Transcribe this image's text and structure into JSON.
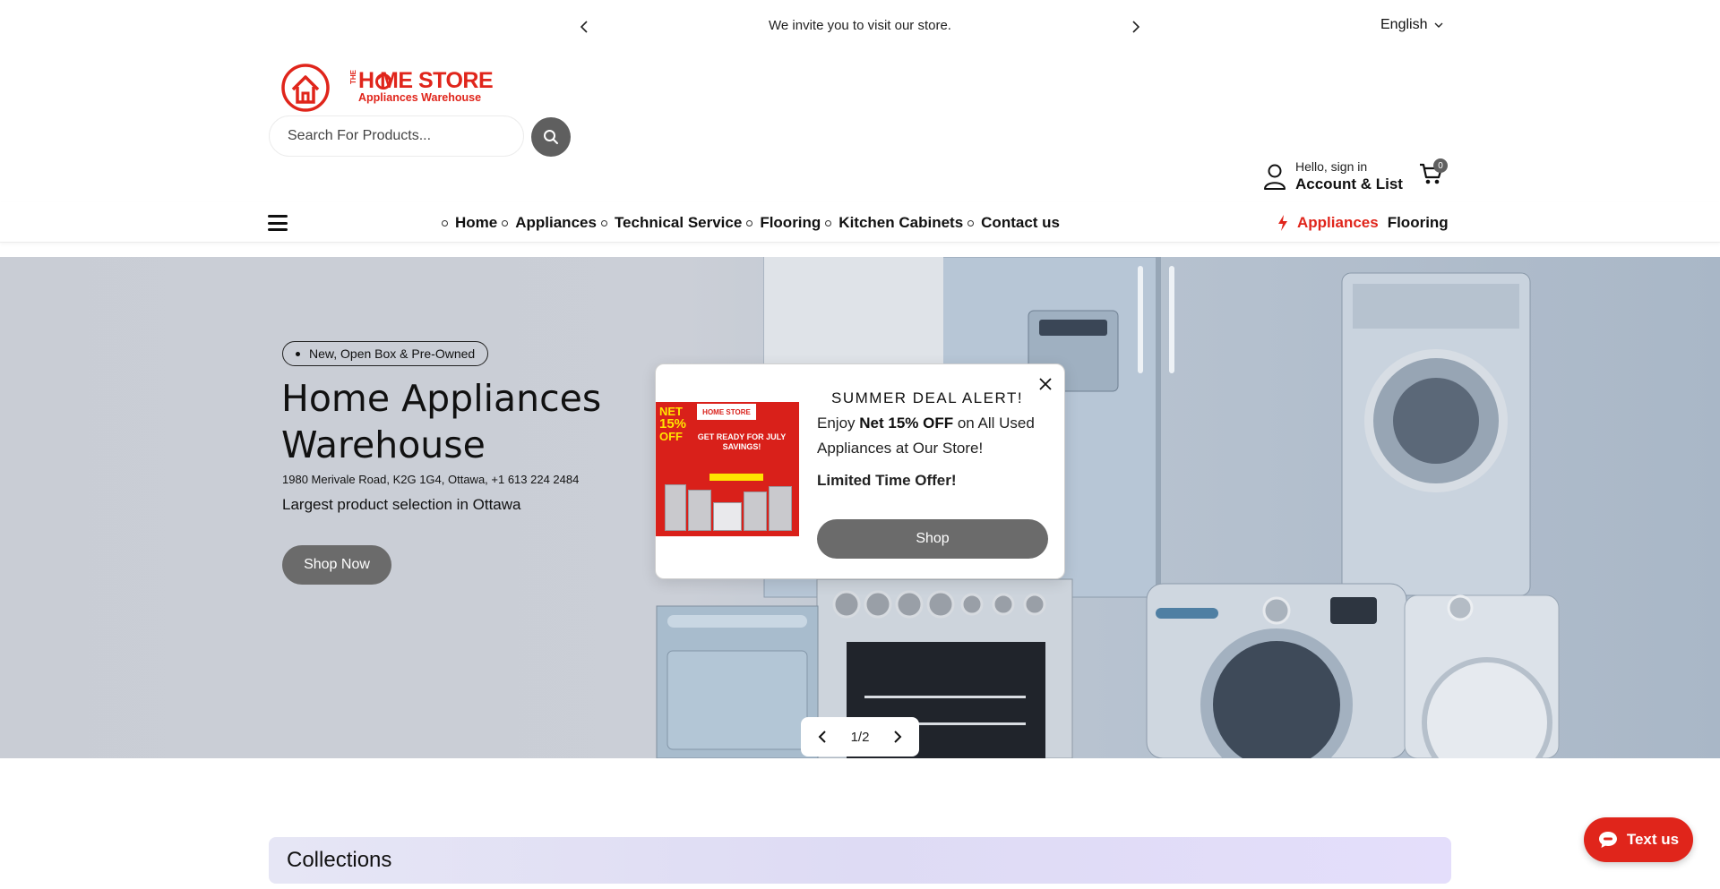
{
  "announcement": {
    "message": "We invite you to visit our store."
  },
  "language": {
    "selected": "English"
  },
  "brand": {
    "the": "THE",
    "name": "H  ME STORE",
    "subtitle": "Appliances Warehouse",
    "color": "#e0251b"
  },
  "search": {
    "placeholder": "Search For Products..."
  },
  "account": {
    "greeting": "Hello, sign in",
    "label": "Account & List"
  },
  "cart": {
    "count": "0"
  },
  "nav": {
    "items": [
      {
        "label": "Home"
      },
      {
        "label": "Appliances"
      },
      {
        "label": "Technical Service"
      },
      {
        "label": "Flooring"
      },
      {
        "label": "Kitchen Cabinets"
      },
      {
        "label": "Contact us"
      }
    ],
    "quick_links": [
      {
        "label": "Appliances",
        "color": "#e0251b"
      },
      {
        "label": "Flooring",
        "color": "#111111"
      }
    ]
  },
  "hero": {
    "tag": "New, Open Box & Pre-Owned",
    "title": "Home Appliances Warehouse",
    "address": "1980 Merivale Road, K2G 1G4, Ottawa, +1 613 224 2484",
    "subtitle": "Largest product selection in Ottawa",
    "cta": "Shop Now",
    "slide_counter": "1/2"
  },
  "popup": {
    "title": "SUMMER DEAL ALERT!",
    "body_prefix": "Enjoy ",
    "body_bold": "Net 15% OFF",
    "body_suffix": " on All Used Appliances at Our Store!",
    "limited": "Limited Time Offer!",
    "cta": "Shop",
    "promo": {
      "net": "NET",
      "percent": "15%",
      "off": "OFF",
      "logo": "HOME STORE",
      "headline": "GET READY FOR JULY SAVINGS!"
    }
  },
  "collections": {
    "title": "Collections"
  },
  "chat": {
    "label": "Text us"
  }
}
